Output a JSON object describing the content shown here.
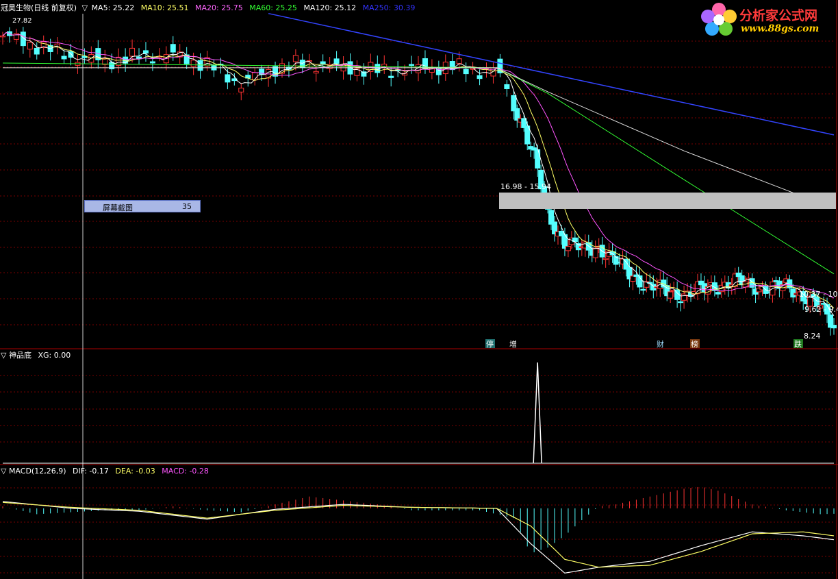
{
  "header": {
    "stock": "冠昊生物(日线 前复权)",
    "arrow": "▽",
    "ma": [
      {
        "label": "MA5: 25.22",
        "color": "#ffffff"
      },
      {
        "label": "MA10: 25.51",
        "color": "#ffff66"
      },
      {
        "label": "MA20: 25.75",
        "color": "#ff66ff"
      },
      {
        "label": "MA60: 25.25",
        "color": "#33ff33"
      },
      {
        "label": "MA120: 25.12",
        "color": "#ffffff"
      },
      {
        "label": "MA250: 30.39",
        "color": "#3333ff"
      }
    ]
  },
  "logo": {
    "title": "分析家公式网",
    "url": "www.88gs.com"
  },
  "screenshot_box": {
    "label": "屏幕截图",
    "value": "35"
  },
  "price_panel": {
    "high_label": "27.82",
    "gap_label": "16.98 - 15.94",
    "right_labels": [
      "10.37 - 10",
      "9.62 - 9.4",
      "8.24"
    ],
    "markers": [
      "停",
      "增",
      "财",
      "榜",
      "跌"
    ]
  },
  "indicator_panel": {
    "title": "▽ 神品底",
    "value": "XG: 0.00"
  },
  "macd_panel": {
    "title": "▽ MACD(12,26,9)",
    "dif": "DIF: -0.17",
    "dea": "DEA: -0.03",
    "macd": "MACD: -0.28"
  },
  "colors": {
    "up": "#ff3333",
    "down": "#54ffff",
    "grid": "#7a0000",
    "border": "#aa0000"
  },
  "chart_data": {
    "type": "line",
    "y_range": [
      8.0,
      28.5
    ],
    "close_path": [
      [
        0,
        27.2
      ],
      [
        10,
        26.6
      ],
      [
        20,
        25.9
      ],
      [
        30,
        25.6
      ],
      [
        40,
        25.9
      ],
      [
        50,
        26.0
      ],
      [
        60,
        25.4
      ],
      [
        70,
        24.2
      ],
      [
        80,
        25.2
      ],
      [
        90,
        25.5
      ],
      [
        100,
        25.2
      ],
      [
        110,
        25.0
      ],
      [
        120,
        25.1
      ],
      [
        130,
        25.3
      ],
      [
        140,
        25.0
      ],
      [
        145,
        25.1
      ],
      [
        152,
        22.0
      ],
      [
        156,
        19.5
      ],
      [
        160,
        16.0
      ],
      [
        165,
        14.3
      ],
      [
        170,
        13.8
      ],
      [
        175,
        14.0
      ],
      [
        180,
        13.0
      ],
      [
        185,
        12.2
      ],
      [
        190,
        11.5
      ],
      [
        195,
        11.2
      ],
      [
        200,
        11.0
      ],
      [
        205,
        11.3
      ],
      [
        210,
        11.6
      ],
      [
        215,
        11.8
      ],
      [
        220,
        11.6
      ],
      [
        225,
        11.4
      ],
      [
        230,
        11.5
      ],
      [
        235,
        11.0
      ],
      [
        240,
        10.2
      ],
      [
        244,
        9.0
      ]
    ],
    "ma250_path": [
      [
        78,
        28.6
      ],
      [
        244,
        21.0
      ]
    ],
    "ma120_path": [
      [
        0,
        25.2
      ],
      [
        145,
        25.2
      ],
      [
        160,
        23.7
      ],
      [
        200,
        20.0
      ],
      [
        244,
        16.4
      ]
    ],
    "ma60_path": [
      [
        0,
        25.5
      ],
      [
        145,
        25.2
      ],
      [
        160,
        23.6
      ],
      [
        200,
        18.2
      ],
      [
        244,
        12.3
      ]
    ],
    "indicator_spike_at": 157,
    "macd_dif_path": [
      [
        0,
        0.35
      ],
      [
        20,
        0.0
      ],
      [
        40,
        -0.15
      ],
      [
        60,
        -0.55
      ],
      [
        80,
        -0.05
      ],
      [
        100,
        0.2
      ],
      [
        120,
        0.05
      ],
      [
        145,
        0.0
      ],
      [
        155,
        -1.8
      ],
      [
        165,
        -3.3
      ],
      [
        175,
        -3.0
      ],
      [
        190,
        -2.7
      ],
      [
        205,
        -1.9
      ],
      [
        220,
        -1.2
      ],
      [
        235,
        -1.4
      ],
      [
        244,
        -1.6
      ]
    ],
    "macd_dea_path": [
      [
        0,
        0.3
      ],
      [
        20,
        0.05
      ],
      [
        40,
        -0.1
      ],
      [
        60,
        -0.5
      ],
      [
        80,
        -0.1
      ],
      [
        100,
        0.15
      ],
      [
        120,
        0.05
      ],
      [
        145,
        0.0
      ],
      [
        155,
        -0.9
      ],
      [
        165,
        -2.6
      ],
      [
        175,
        -3.0
      ],
      [
        190,
        -2.9
      ],
      [
        205,
        -2.2
      ],
      [
        220,
        -1.3
      ],
      [
        235,
        -1.2
      ],
      [
        244,
        -1.4
      ]
    ],
    "macd_hist": [
      [
        0,
        0.1
      ],
      [
        10,
        -0.3
      ],
      [
        20,
        -0.2
      ],
      [
        30,
        -0.1
      ],
      [
        40,
        -0.1
      ],
      [
        50,
        0.1
      ],
      [
        60,
        -0.1
      ],
      [
        70,
        -0.2
      ],
      [
        80,
        0.2
      ],
      [
        90,
        0.6
      ],
      [
        100,
        0.4
      ],
      [
        110,
        0.2
      ],
      [
        120,
        -0.1
      ],
      [
        130,
        -0.1
      ],
      [
        140,
        -0.1
      ],
      [
        150,
        -0.5
      ],
      [
        155,
        -2.3
      ],
      [
        160,
        -2.0
      ],
      [
        165,
        -1.4
      ],
      [
        170,
        -0.6
      ],
      [
        175,
        0.1
      ],
      [
        180,
        0.2
      ],
      [
        190,
        0.6
      ],
      [
        200,
        1.0
      ],
      [
        205,
        1.1
      ],
      [
        210,
        0.9
      ],
      [
        220,
        0.2
      ],
      [
        230,
        -0.1
      ],
      [
        240,
        -0.3
      ],
      [
        244,
        -0.28
      ]
    ],
    "macd_range": [
      -3.6,
      1.6
    ]
  }
}
